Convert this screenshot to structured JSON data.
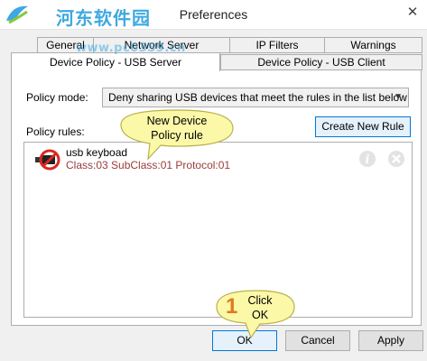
{
  "window": {
    "title": "Preferences",
    "close_glyph": "✕"
  },
  "watermark": {
    "title": "河东软件园",
    "url": "www.pc0359.cn"
  },
  "tabs": [
    {
      "label": "General",
      "active": false
    },
    {
      "label": "Network Server",
      "active": false
    },
    {
      "label": "IP Filters",
      "active": false
    },
    {
      "label": "Warnings",
      "active": false
    },
    {
      "label": "Device Policy - USB Server",
      "active": true
    },
    {
      "label": "Device Policy - USB Client",
      "active": false
    }
  ],
  "policy": {
    "mode_label": "Policy mode:",
    "mode_value": "Deny sharing USB devices that meet the rules in the list below",
    "rules_label": "Policy rules:",
    "create_rule_label": "Create New Rule"
  },
  "rules": [
    {
      "name": "usb keyboad",
      "details": "Class:03  SubClass:01  Protocol:01",
      "icon": "blocked-usb-icon"
    }
  ],
  "callouts": {
    "new_rule": "New Device\nPolicy rule",
    "step_number": "1",
    "click_ok": "Click\nOK"
  },
  "footer": {
    "ok_label": "OK",
    "cancel_label": "Cancel",
    "apply_label": "Apply"
  },
  "colors": {
    "watermark": "#3ea9e0",
    "callout_fill": "#fbf8a8",
    "callout_border": "#b9b24a",
    "step_number": "#e07a1a",
    "rule_details": "#9a3b3b"
  }
}
